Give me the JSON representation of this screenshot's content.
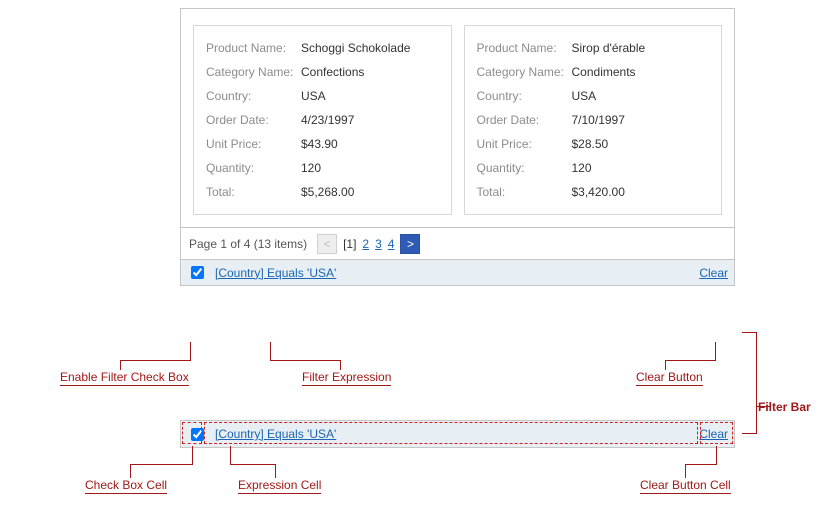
{
  "cards": [
    {
      "product_name_label": "Product Name:",
      "product_name": "Schoggi Schokolade",
      "category_label": "Category Name:",
      "category": "Confections",
      "country_label": "Country:",
      "country": "USA",
      "order_date_label": "Order Date:",
      "order_date": "4/23/1997",
      "unit_price_label": "Unit Price:",
      "unit_price": "$43.90",
      "quantity_label": "Quantity:",
      "quantity": "120",
      "total_label": "Total:",
      "total": "$5,268.00"
    },
    {
      "product_name_label": "Product Name:",
      "product_name": "Sirop d'érable",
      "category_label": "Category Name:",
      "category": "Condiments",
      "country_label": "Country:",
      "country": "USA",
      "order_date_label": "Order Date:",
      "order_date": "7/10/1997",
      "unit_price_label": "Unit Price:",
      "unit_price": "$28.50",
      "quantity_label": "Quantity:",
      "quantity": "120",
      "total_label": "Total:",
      "total": "$3,420.00"
    }
  ],
  "pager": {
    "summary": "Page 1 of 4 (13 items)",
    "prev_glyph": "<",
    "current": "[1]",
    "page2": "2",
    "page3": "3",
    "page4": "4",
    "next_glyph": ">"
  },
  "filter": {
    "expression": "[Country] Equals 'USA'",
    "clear": "Clear"
  },
  "annotations": {
    "enable_cb": "Enable Filter Check Box",
    "filter_expr": "Filter Expression",
    "clear_btn": "Clear Button",
    "filter_bar": "Filter Bar",
    "cb_cell": "Check Box Cell",
    "expr_cell": "Expression Cell",
    "clear_cell": "Clear Button Cell"
  }
}
